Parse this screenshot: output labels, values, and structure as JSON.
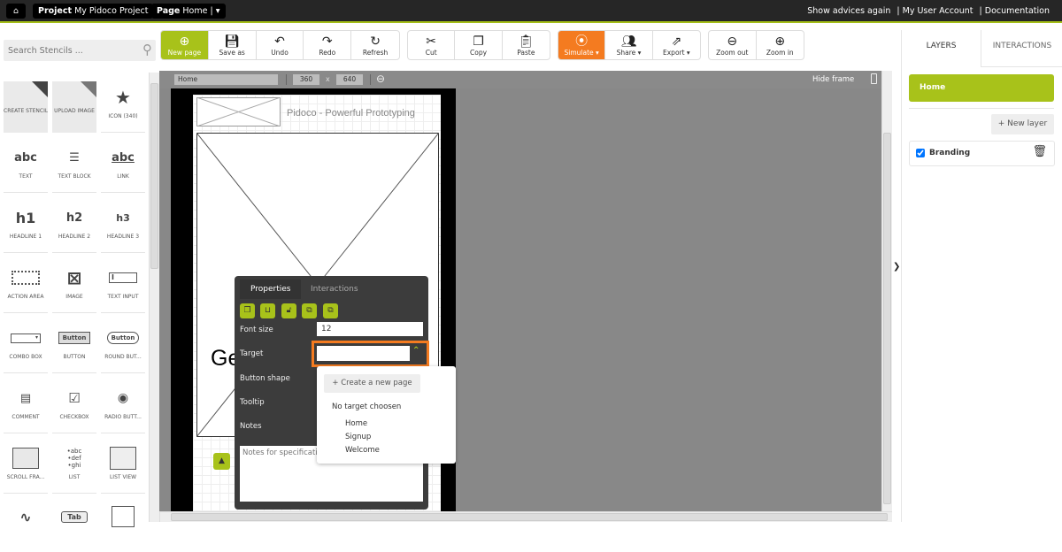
{
  "topbar": {
    "project_label": "Project",
    "project_name": "My Pidoco Project",
    "page_label": "Page",
    "page_name": "Home",
    "links": [
      "Show advices again",
      "| My User Account",
      "| Documentation"
    ]
  },
  "stencils": {
    "search_placeholder": "Search Stencils ...",
    "items": [
      "CREATE STENCIL",
      "UPLOAD IMAGE",
      "ICON (340)",
      "TEXT",
      "TEXT BLOCK",
      "LINK",
      "HEADLINE 1",
      "HEADLINE 2",
      "HEADLINE 3",
      "ACTION AREA",
      "IMAGE",
      "TEXT INPUT",
      "COMBO BOX",
      "BUTTON",
      "ROUND BUT...",
      "COMMENT",
      "CHECKBOX",
      "RADIO BUTT...",
      "SCROLL FRA...",
      "LIST",
      "LIST VIEW"
    ],
    "icons": [
      "abc",
      "abc",
      "h1",
      "h2",
      "h3",
      "Button",
      "Button",
      "Tab"
    ]
  },
  "toolbar": {
    "new_page": "New page",
    "save_as": "Save as",
    "undo": "Undo",
    "redo": "Redo",
    "refresh": "Refresh",
    "cut": "Cut",
    "copy": "Copy",
    "paste": "Paste",
    "simulate": "Simulate ▾",
    "share": "Share ▾",
    "export": "Export ▾",
    "zoom_out": "Zoom out",
    "zoom_in": "Zoom in"
  },
  "canvas": {
    "page_name": "Home",
    "width": "360",
    "x": "x",
    "height": "640",
    "hide_frame": "Hide frame",
    "header_text": "Pidoco - Powerful Prototyping",
    "partial_text": "Ge"
  },
  "properties": {
    "tabs": [
      "Properties",
      "Interactions"
    ],
    "font_size_label": "Font size",
    "font_size": "12",
    "target_label": "Target",
    "button_shape_label": "Button shape",
    "tooltip_label": "Tooltip",
    "notes_label": "Notes",
    "notes_placeholder": "Notes for specification"
  },
  "dropdown": {
    "create": "+ Create a new page",
    "none": "No target choosen",
    "pages": [
      "Home",
      "Signup",
      "Welcome"
    ]
  },
  "right_panel": {
    "tabs": [
      "LAYERS",
      "INTERACTIONS"
    ],
    "page": "Home",
    "new_layer": "+ New layer",
    "layers": [
      {
        "name": "Branding",
        "checked": true
      }
    ]
  },
  "colors": {
    "accent": "#a8c21a",
    "simulate": "#f47b20",
    "topbar": "#262626"
  }
}
